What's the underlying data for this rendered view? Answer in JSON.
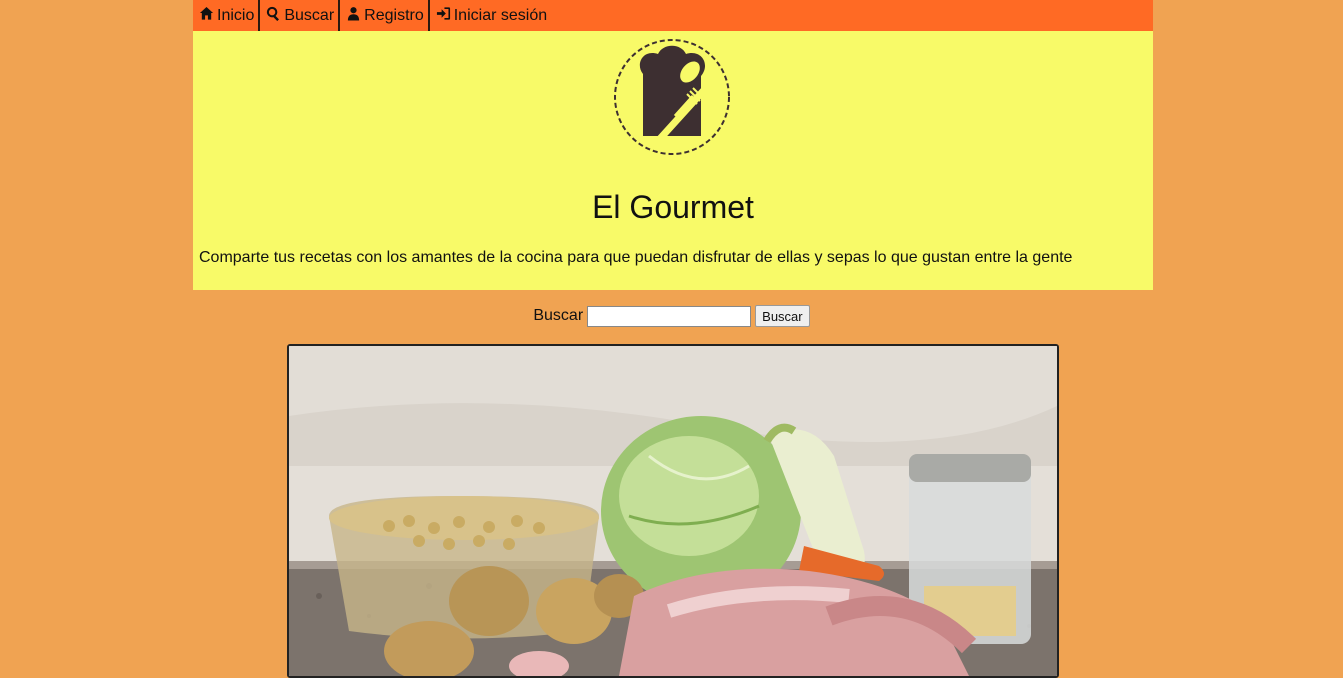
{
  "nav": {
    "items": [
      {
        "label": "Inicio",
        "icon": "home-icon"
      },
      {
        "label": "Buscar",
        "icon": "search-icon"
      },
      {
        "label": "Registro",
        "icon": "user-icon"
      },
      {
        "label": "Iniciar sesión",
        "icon": "sign-in-icon"
      }
    ]
  },
  "header": {
    "logo_icon": "chef-hat-utensils-logo",
    "title": "El Gourmet",
    "tagline": "Comparte tus recetas con los amantes de la cocina para que puedan disfrutar de ellas y sepas lo que gustan entre la gente"
  },
  "search": {
    "label": "Buscar",
    "value": "",
    "button_label": "Buscar"
  },
  "colors": {
    "page_bg": "#f0a352",
    "nav_bg": "#ff6a24",
    "header_bg": "#f8fa68",
    "logo_dark": "#3d2f31"
  }
}
